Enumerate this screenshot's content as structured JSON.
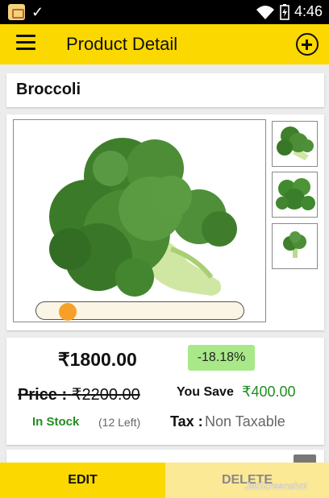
{
  "status_bar": {
    "time": "4:46"
  },
  "app_bar": {
    "title": "Product Detail"
  },
  "product": {
    "name": "Broccoli",
    "image_position": 0.12,
    "thumbnail_count": 3
  },
  "pricing": {
    "price": "₹1800.00",
    "discount": "-18.18%",
    "original_label": "Price :",
    "original_price": "₹2200.00",
    "save_label": "You Save",
    "save_value": "₹400.00",
    "stock_status": "In Stock",
    "stock_left": "(12 Left)",
    "tax_label": "Tax :",
    "tax_value": "Non Taxable"
  },
  "actions": {
    "edit": "EDIT",
    "delete": "DELETE"
  },
  "watermark": "JetScreenshot",
  "colors": {
    "accent": "#fbd800",
    "in_stock": "#1e8f1e",
    "discount_bg": "#a8e889",
    "slider_knob": "#f7a028"
  }
}
